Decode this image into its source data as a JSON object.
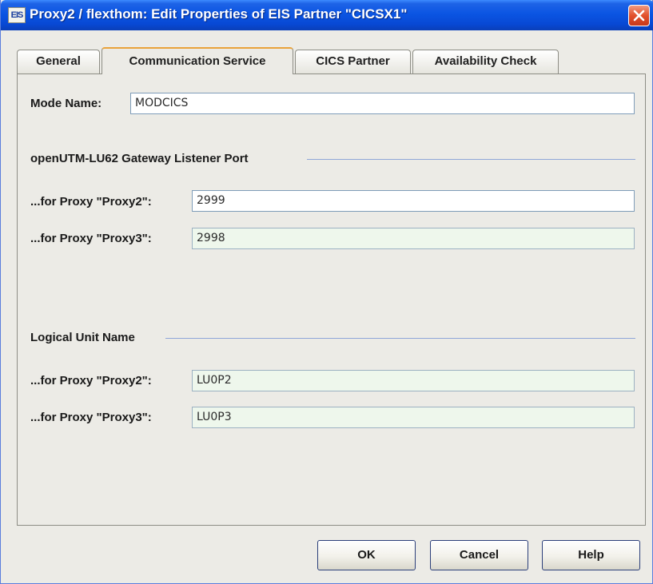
{
  "window": {
    "title": "Proxy2 / flexthom: Edit Properties of EIS Partner \"CICSX1\"",
    "app_icon_text": "EIS",
    "accent": "#0b55e3"
  },
  "tabs": [
    {
      "label": "General",
      "selected": false
    },
    {
      "label": "Communication Service",
      "selected": true
    },
    {
      "label": "CICS Partner",
      "selected": false
    },
    {
      "label": "Availability Check",
      "selected": false
    }
  ],
  "mode": {
    "label": "Mode Name:",
    "value": "MODCICS"
  },
  "gateway_section": {
    "title": "openUTM-LU62 Gateway Listener Port",
    "rows": [
      {
        "label": "...for Proxy \"Proxy2\":",
        "value": "2999",
        "editable": true
      },
      {
        "label": "...for Proxy \"Proxy3\":",
        "value": "2998",
        "editable": false
      }
    ]
  },
  "lu_section": {
    "title": "Logical Unit Name",
    "rows": [
      {
        "label": "...for Proxy \"Proxy2\":",
        "value": "LU0P2",
        "editable": false
      },
      {
        "label": "...for Proxy \"Proxy3\":",
        "value": "LU0P3",
        "editable": false
      }
    ]
  },
  "buttons": {
    "ok": "OK",
    "cancel": "Cancel",
    "help": "Help"
  }
}
